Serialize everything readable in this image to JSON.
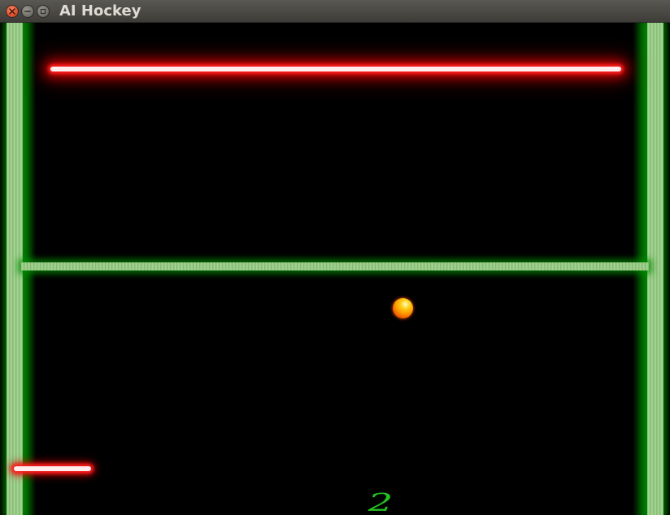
{
  "window": {
    "title": "AI Hockey",
    "buttons": [
      "close",
      "minimize",
      "maximize"
    ]
  },
  "game": {
    "score": "2",
    "colors": {
      "background": "#000000",
      "wall": "#8bc47a",
      "wall_glow": "#008c00",
      "paddle": "#ff2020",
      "puck": "#ff9a00",
      "score_text": "#22c21e"
    }
  }
}
